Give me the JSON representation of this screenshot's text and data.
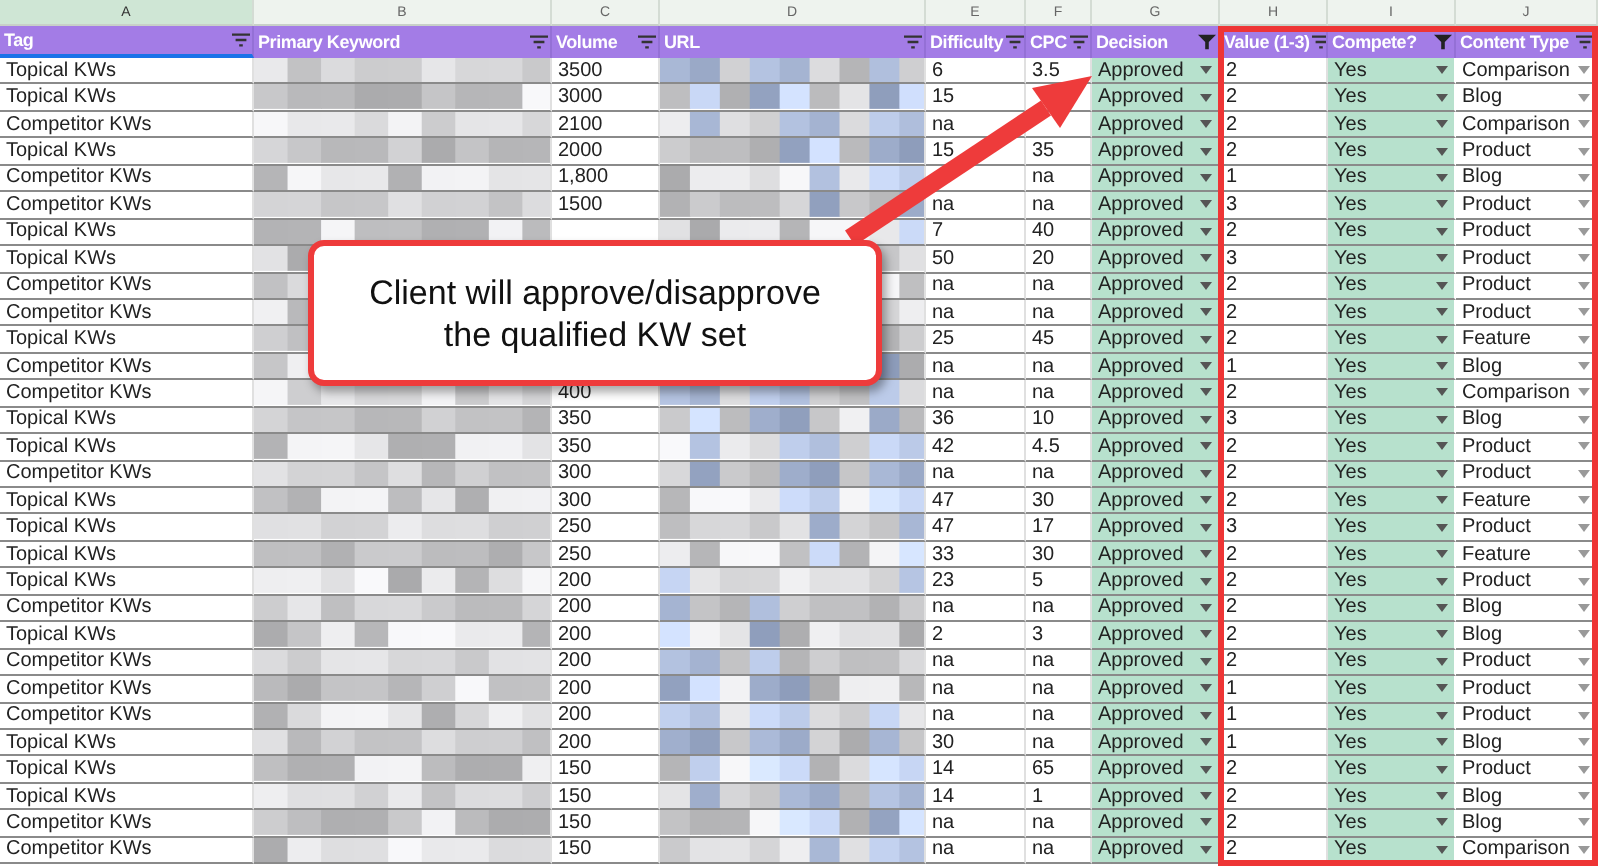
{
  "column_letters": [
    {
      "label": "A",
      "selected": true
    },
    {
      "label": "B",
      "selected": false
    },
    {
      "label": "C",
      "selected": false
    },
    {
      "label": "D",
      "selected": false
    },
    {
      "label": "E",
      "selected": false
    },
    {
      "label": "F",
      "selected": false
    },
    {
      "label": "G",
      "selected": false
    },
    {
      "label": "H",
      "selected": false
    },
    {
      "label": "I",
      "selected": false
    },
    {
      "label": "J",
      "selected": false
    }
  ],
  "columns": [
    {
      "label": "Tag",
      "filtered": false
    },
    {
      "label": "Primary Keyword",
      "filtered": false
    },
    {
      "label": "Volume",
      "filtered": false
    },
    {
      "label": "URL",
      "filtered": false
    },
    {
      "label": "Difficulty",
      "filtered": false
    },
    {
      "label": "CPC",
      "filtered": false
    },
    {
      "label": "Decision",
      "filtered": true
    },
    {
      "label": "Value (1-3)",
      "filtered": false
    },
    {
      "label": "Compete?",
      "filtered": true
    },
    {
      "label": "Content Type",
      "filtered": false
    }
  ],
  "rows": [
    {
      "tag": "Topical KWs",
      "volume": "3500",
      "difficulty": "6",
      "cpc": "3.5",
      "decision": "Approved",
      "value": "2",
      "compete": "Yes",
      "content_type": "Comparison"
    },
    {
      "tag": "Topical KWs",
      "volume": "3000",
      "difficulty": "15",
      "decision": "Approved",
      "value": "2",
      "compete": "Yes",
      "content_type": "Blog"
    },
    {
      "tag": "Competitor KWs",
      "volume": "2100",
      "difficulty": "na",
      "decision": "Approved",
      "value": "2",
      "compete": "Yes",
      "content_type": "Comparison"
    },
    {
      "tag": "Topical KWs",
      "volume": "2000",
      "difficulty": "15",
      "cpc": "35",
      "decision": "Approved",
      "value": "2",
      "compete": "Yes",
      "content_type": "Product"
    },
    {
      "tag": "Competitor KWs",
      "volume": "1,800",
      "cpc": "na",
      "decision": "Approved",
      "value": "1",
      "compete": "Yes",
      "content_type": "Blog"
    },
    {
      "tag": "Competitor KWs",
      "volume": "1500",
      "difficulty": "na",
      "cpc": "na",
      "decision": "Approved",
      "value": "3",
      "compete": "Yes",
      "content_type": "Product"
    },
    {
      "tag": "Topical KWs",
      "difficulty": "7",
      "cpc": "40",
      "decision": "Approved",
      "value": "2",
      "compete": "Yes",
      "content_type": "Product"
    },
    {
      "tag": "Topical KWs",
      "difficulty": "50",
      "cpc": "20",
      "decision": "Approved",
      "value": "3",
      "compete": "Yes",
      "content_type": "Product"
    },
    {
      "tag": "Competitor KWs",
      "difficulty": "na",
      "cpc": "na",
      "decision": "Approved",
      "value": "2",
      "compete": "Yes",
      "content_type": "Product"
    },
    {
      "tag": "Competitor KWs",
      "difficulty": "na",
      "cpc": "na",
      "decision": "Approved",
      "value": "2",
      "compete": "Yes",
      "content_type": "Product"
    },
    {
      "tag": "Topical KWs",
      "difficulty": "25",
      "cpc": "45",
      "decision": "Approved",
      "value": "2",
      "compete": "Yes",
      "content_type": "Feature"
    },
    {
      "tag": "Competitor KWs",
      "difficulty": "na",
      "cpc": "na",
      "decision": "Approved",
      "value": "1",
      "compete": "Yes",
      "content_type": "Blog"
    },
    {
      "tag": "Competitor KWs",
      "volume": "400",
      "difficulty": "na",
      "cpc": "na",
      "decision": "Approved",
      "value": "2",
      "compete": "Yes",
      "content_type": "Comparison"
    },
    {
      "tag": "Topical KWs",
      "volume": "350",
      "difficulty": "36",
      "cpc": "10",
      "decision": "Approved",
      "value": "3",
      "compete": "Yes",
      "content_type": "Blog"
    },
    {
      "tag": "Topical KWs",
      "volume": "350",
      "difficulty": "42",
      "cpc": "4.5",
      "decision": "Approved",
      "value": "2",
      "compete": "Yes",
      "content_type": "Product"
    },
    {
      "tag": "Competitor KWs",
      "volume": "300",
      "difficulty": "na",
      "cpc": "na",
      "decision": "Approved",
      "value": "2",
      "compete": "Yes",
      "content_type": "Product"
    },
    {
      "tag": "Topical KWs",
      "volume": "300",
      "difficulty": "47",
      "cpc": "30",
      "decision": "Approved",
      "value": "2",
      "compete": "Yes",
      "content_type": "Feature"
    },
    {
      "tag": "Topical KWs",
      "volume": "250",
      "difficulty": "47",
      "cpc": "17",
      "decision": "Approved",
      "value": "3",
      "compete": "Yes",
      "content_type": "Product"
    },
    {
      "tag": "Topical KWs",
      "volume": "250",
      "difficulty": "33",
      "cpc": "30",
      "decision": "Approved",
      "value": "2",
      "compete": "Yes",
      "content_type": "Feature"
    },
    {
      "tag": "Topical KWs",
      "volume": "200",
      "difficulty": "23",
      "cpc": "5",
      "decision": "Approved",
      "value": "2",
      "compete": "Yes",
      "content_type": "Product"
    },
    {
      "tag": "Competitor KWs",
      "volume": "200",
      "difficulty": "na",
      "cpc": "na",
      "decision": "Approved",
      "value": "2",
      "compete": "Yes",
      "content_type": "Blog"
    },
    {
      "tag": "Topical KWs",
      "volume": "200",
      "difficulty": "2",
      "cpc": "3",
      "decision": "Approved",
      "value": "2",
      "compete": "Yes",
      "content_type": "Blog"
    },
    {
      "tag": "Competitor KWs",
      "volume": "200",
      "difficulty": "na",
      "cpc": "na",
      "decision": "Approved",
      "value": "2",
      "compete": "Yes",
      "content_type": "Product"
    },
    {
      "tag": "Competitor KWs",
      "volume": "200",
      "difficulty": "na",
      "cpc": "na",
      "decision": "Approved",
      "value": "1",
      "compete": "Yes",
      "content_type": "Product"
    },
    {
      "tag": "Competitor KWs",
      "volume": "200",
      "difficulty": "na",
      "cpc": "na",
      "decision": "Approved",
      "value": "1",
      "compete": "Yes",
      "content_type": "Product"
    },
    {
      "tag": "Topical KWs",
      "volume": "200",
      "difficulty": "30",
      "cpc": "na",
      "decision": "Approved",
      "value": "1",
      "compete": "Yes",
      "content_type": "Blog"
    },
    {
      "tag": "Topical KWs",
      "volume": "150",
      "difficulty": "14",
      "cpc": "65",
      "decision": "Approved",
      "value": "2",
      "compete": "Yes",
      "content_type": "Product"
    },
    {
      "tag": "Topical KWs",
      "volume": "150",
      "difficulty": "14",
      "cpc": "1",
      "decision": "Approved",
      "value": "2",
      "compete": "Yes",
      "content_type": "Blog"
    },
    {
      "tag": "Competitor KWs",
      "volume": "150",
      "difficulty": "na",
      "cpc": "na",
      "decision": "Approved",
      "value": "2",
      "compete": "Yes",
      "content_type": "Blog"
    },
    {
      "tag": "Competitor KWs",
      "volume": "150",
      "difficulty": "na",
      "cpc": "na",
      "decision": "Approved",
      "value": "2",
      "compete": "Yes",
      "content_type": "Comparison"
    }
  ],
  "callout": {
    "text": "Client will approve/disapprove the qualified KW set"
  }
}
